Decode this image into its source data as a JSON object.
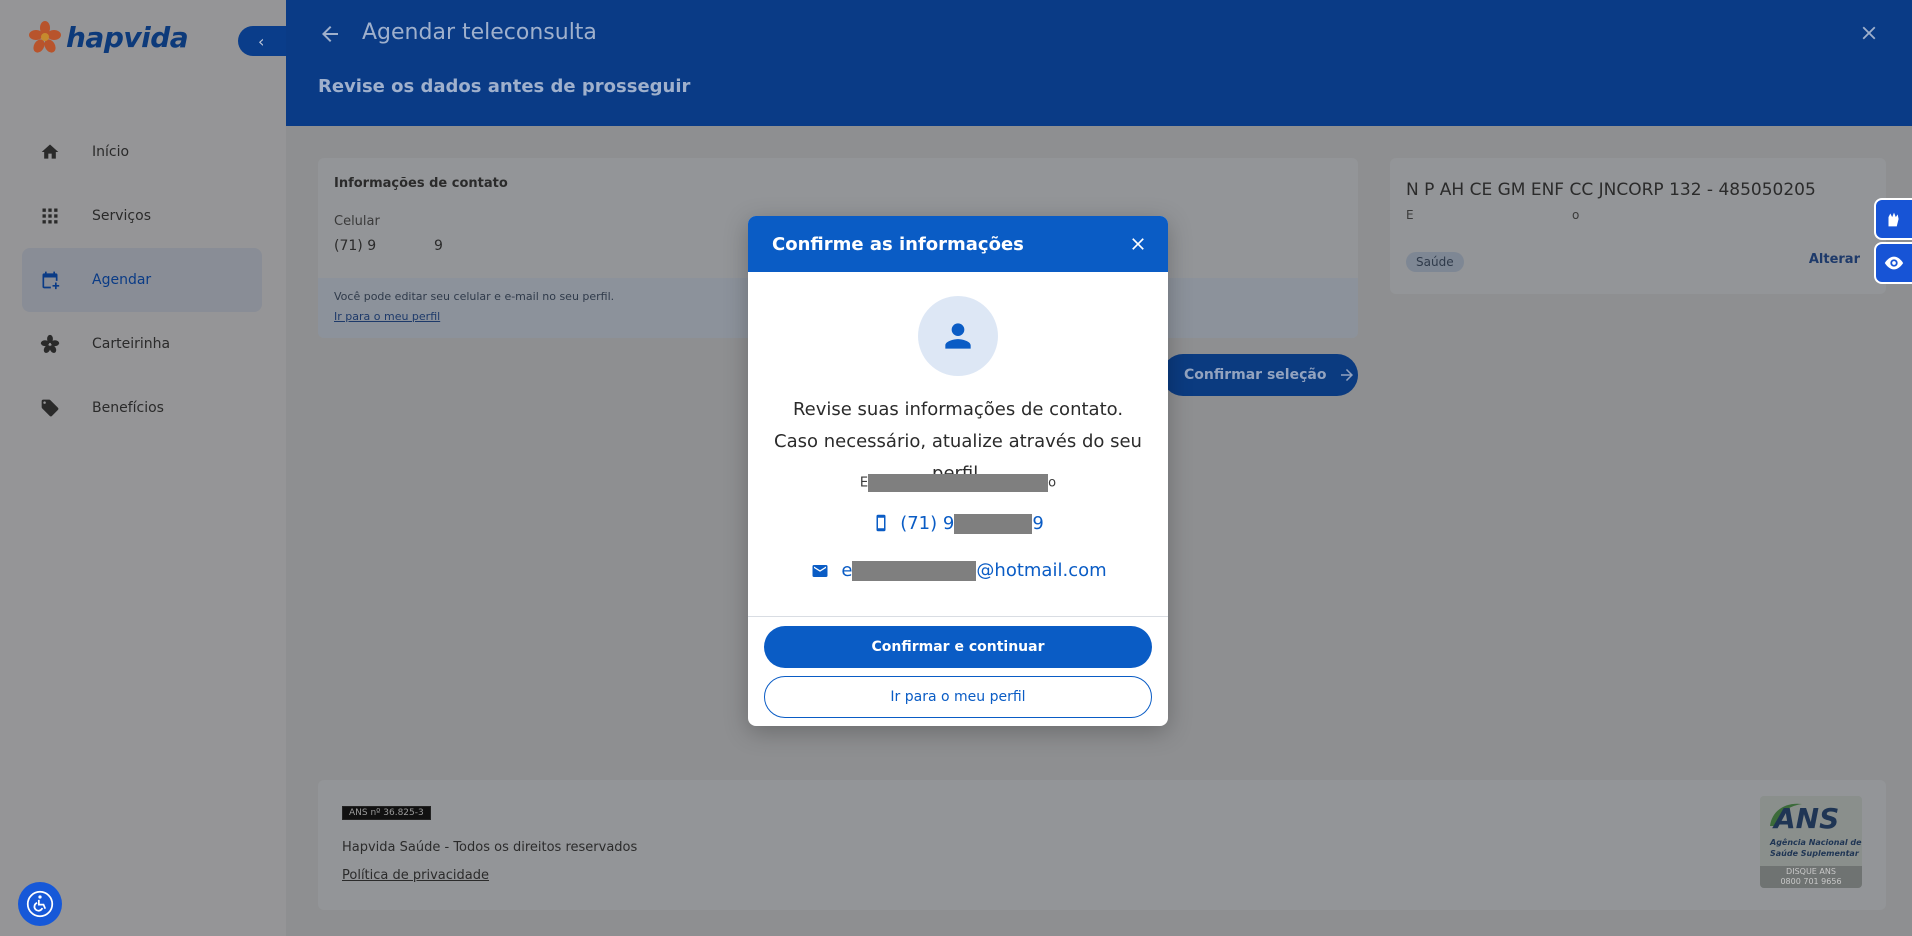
{
  "sidebar": {
    "logo_text": "hapvida",
    "items": [
      {
        "label": "Início",
        "icon": "home-icon"
      },
      {
        "label": "Serviços",
        "icon": "grid-icon"
      },
      {
        "label": "Agendar",
        "icon": "calendar-add-icon",
        "active": true
      },
      {
        "label": "Carteirinha",
        "icon": "flower-icon"
      },
      {
        "label": "Benefícios",
        "icon": "tag-icon"
      }
    ]
  },
  "header": {
    "title": "Agendar teleconsulta",
    "subtitle": "Revise os dados antes de prosseguir"
  },
  "contact_card": {
    "title": "Informações de contato",
    "phone_label": "Celular",
    "phone_value": "(71) 9",
    "phone_value_end": "9",
    "note": "Você pode editar seu celular e e-mail no seu perfil.",
    "note_link": "Ir para o meu perfil"
  },
  "plan_card": {
    "title": "N P AH CE GM ENF CC JNCORP 132 - 485050205",
    "sub_left": "E",
    "sub_right": "o",
    "badge": "Saúde",
    "change_link": "Alterar"
  },
  "confirm_selection": "Confirmar seleção",
  "footer": {
    "ans_number": "ANS nº 36.825-3",
    "copyright": "Hapvida Saúde - Todos os direitos reservados",
    "privacy": "Política de privacidade",
    "ans_logo": {
      "word": "ANS",
      "line1": "Agência Nacional de",
      "line2": "Saúde Suplementar",
      "bottom1": "DISQUE ANS",
      "bottom2": "0800 701 9656"
    }
  },
  "modal": {
    "title": "Confirme as informações",
    "message": "Revise suas informações de contato. Caso necessário, atualize através do seu perfil.",
    "name_start": "E",
    "name_end": "o",
    "phone_start": "(71) 9",
    "phone_end": "9",
    "email_start": "e",
    "email_end": "@hotmail.com",
    "primary_button": "Confirmar e continuar",
    "secondary_button": "Ir para o meu perfil"
  },
  "colors": {
    "brand_blue": "#0a5cc5",
    "header_blue": "#0a3b86",
    "a11y_blue": "#1754d6"
  }
}
